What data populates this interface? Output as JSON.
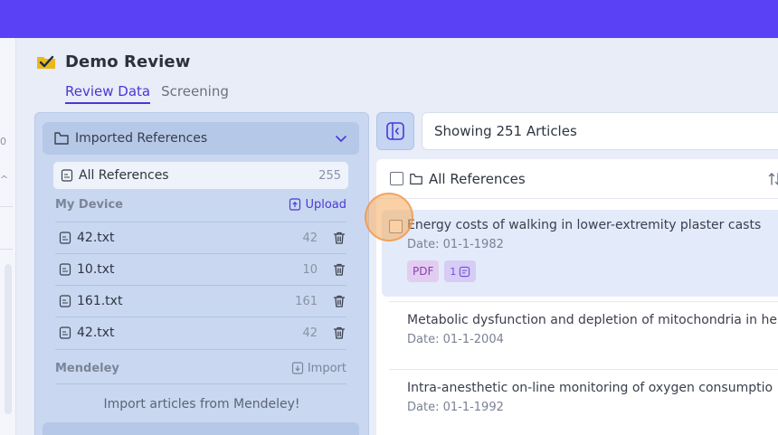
{
  "project": {
    "title": "Demo Review"
  },
  "tabs": [
    {
      "label": "Review Data"
    },
    {
      "label": "Screening"
    }
  ],
  "rail": {
    "mark_top": "0",
    "mark_mid": "^"
  },
  "references_panel": {
    "header": "Imported References",
    "all_references": {
      "label": "All References",
      "count": "255"
    },
    "my_device": {
      "label": "My Device",
      "upload_label": "Upload",
      "files": [
        {
          "name": "42.txt",
          "count": "42"
        },
        {
          "name": "10.txt",
          "count": "10"
        },
        {
          "name": "161.txt",
          "count": "161"
        },
        {
          "name": "42.txt",
          "count": "42"
        }
      ]
    },
    "mendeley": {
      "label": "Mendeley",
      "import_label": "Import",
      "message": "Import articles from Mendeley!"
    }
  },
  "articles_header": {
    "showing": "Showing 251 Articles"
  },
  "article_list": {
    "title": "All References",
    "articles": [
      {
        "title": "Energy costs of walking in lower-extremity plaster casts",
        "date": "Date: 01-1-1982",
        "tag_pdf": "PDF",
        "notes_count": "1"
      },
      {
        "title": "Metabolic dysfunction and depletion of mitochondria in he",
        "date": "Date: 01-1-2004"
      },
      {
        "title": "Intra-anesthetic on-line monitoring of oxygen consumptio",
        "date": "Date: 01-1-1992"
      }
    ]
  },
  "colors": {
    "accent": "#5a41f6",
    "tab_active": "#4a37d6",
    "panel": "#c9d8f0"
  },
  "icons": {
    "project": "folder-check-icon",
    "folder": "folder-icon",
    "chevron": "chevron-down-icon",
    "file": "file-text-icon",
    "upload": "upload-icon",
    "import": "import-icon",
    "trash": "trash-icon",
    "sidebar_toggle": "sidebar-collapse-icon",
    "sort": "sort-icon",
    "notes": "notes-icon"
  }
}
